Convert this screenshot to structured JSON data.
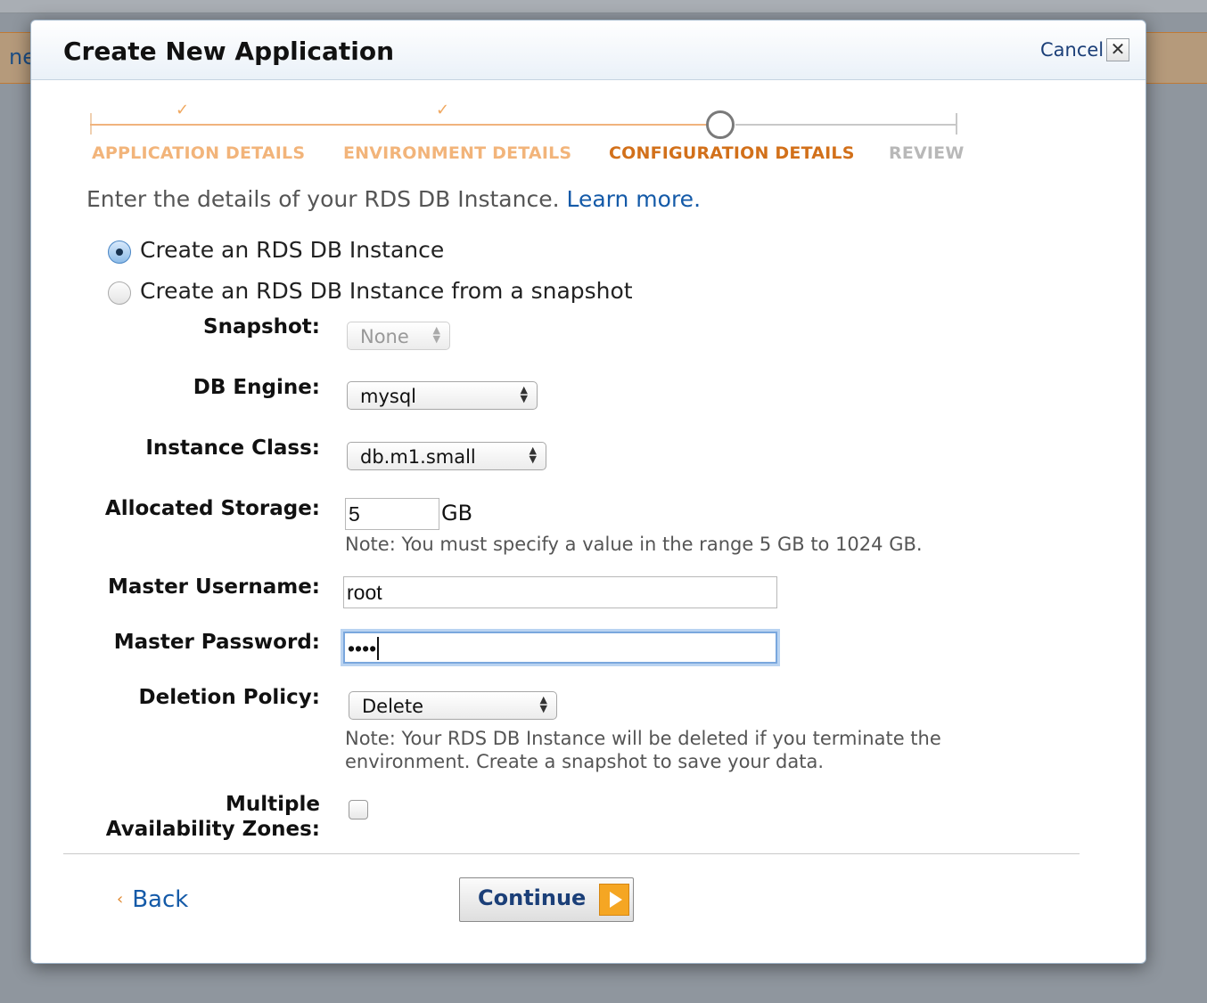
{
  "background": {
    "partial_text": "ne"
  },
  "dialog": {
    "title": "Create New Application",
    "cancel_label": "Cancel",
    "close_glyph": "✕",
    "steps": [
      {
        "label": "APPLICATION DETAILS",
        "state": "done"
      },
      {
        "label": "ENVIRONMENT DETAILS",
        "state": "done"
      },
      {
        "label": "CONFIGURATION DETAILS",
        "state": "current"
      },
      {
        "label": "REVIEW",
        "state": "todo"
      }
    ],
    "check_glyph": "✓",
    "intro_text": "Enter the details of your RDS DB Instance.",
    "learn_more": "Learn more.",
    "radio_options": [
      {
        "label": "Create an RDS DB Instance",
        "checked": true
      },
      {
        "label": "Create an RDS DB Instance from a snapshot",
        "checked": false
      }
    ],
    "form": {
      "snapshot": {
        "label": "Snapshot:",
        "value": "None",
        "disabled": true
      },
      "db_engine": {
        "label": "DB Engine:",
        "value": "mysql"
      },
      "instance_class": {
        "label": "Instance Class:",
        "value": "db.m1.small"
      },
      "allocated_storage": {
        "label": "Allocated Storage:",
        "value": "5",
        "unit": "GB",
        "note": "Note: You must specify a value in the range 5 GB to 1024 GB."
      },
      "master_username": {
        "label": "Master Username:",
        "value": "root"
      },
      "master_password": {
        "label": "Master Password:",
        "value": "••••"
      },
      "deletion_policy": {
        "label": "Deletion Policy:",
        "value": "Delete",
        "note_line1": "Note: Your RDS DB Instance will be deleted if you terminate the",
        "note_line2": "environment. Create a snapshot to save your data."
      },
      "multi_az": {
        "label_line1": "Multiple",
        "label_line2": "Availability Zones:",
        "checked": false
      }
    },
    "back_label": "Back",
    "back_glyph": "‹",
    "continue_label": "Continue"
  },
  "colors": {
    "accent_orange": "#d2701a",
    "link_blue": "#145aa8",
    "button_arrow": "#f5a623"
  }
}
